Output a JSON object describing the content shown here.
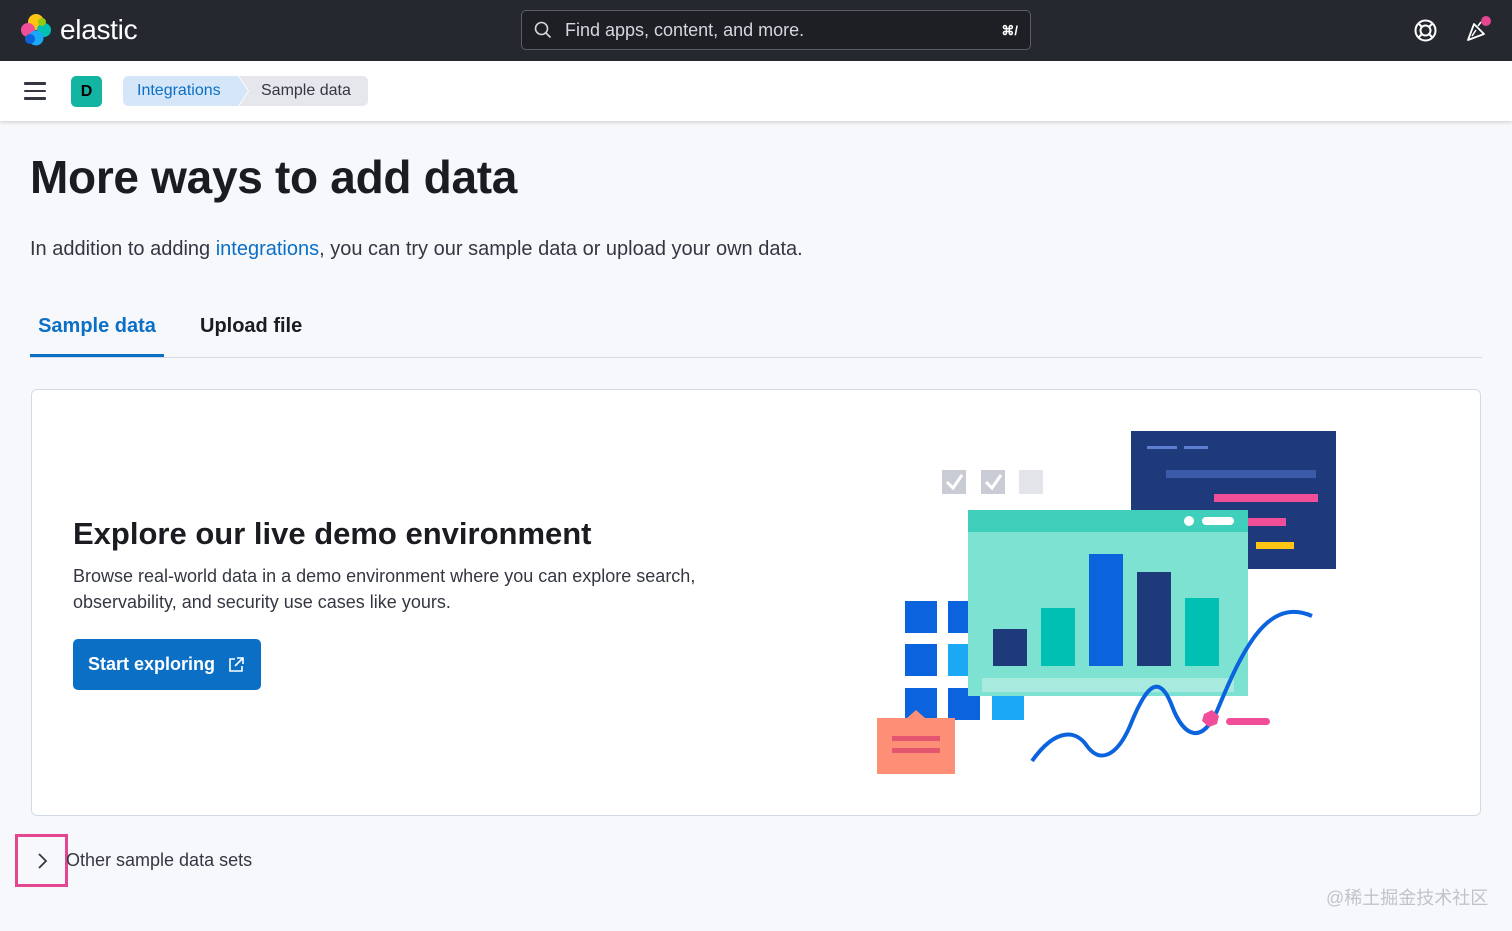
{
  "header": {
    "brand": "elastic",
    "search_placeholder": "Find apps, content, and more.",
    "search_shortcut": "⌘/"
  },
  "breadcrumbs": {
    "space_initial": "D",
    "items": [
      "Integrations",
      "Sample data"
    ]
  },
  "page": {
    "title": "More ways to add data",
    "desc_prefix": "In addition to adding ",
    "desc_link": "integrations",
    "desc_suffix": ", you can try our sample data or upload your own data."
  },
  "tabs": [
    {
      "label": "Sample data",
      "selected": true
    },
    {
      "label": "Upload file",
      "selected": false
    }
  ],
  "demo_panel": {
    "title": "Explore our live demo environment",
    "description": "Browse real-world data in a demo environment where you can explore search, observability, and security use cases like yours.",
    "button_label": "Start exploring"
  },
  "other_sets": {
    "label": "Other sample data sets",
    "expanded": false
  },
  "watermark": "@稀土掘金技术社区",
  "colors": {
    "primary": "#0a6fc5",
    "header_bg": "#25282f",
    "highlight": "#e4468f",
    "space_avatar": "#13b5a2"
  },
  "icons": {
    "logo": "elastic-logo-icon",
    "search": "search-icon",
    "help": "help-lifebuoy-icon",
    "news": "newsfeed-icon",
    "menu": "hamburger-menu-icon",
    "external": "external-link-icon",
    "chevron": "chevron-right-icon"
  }
}
